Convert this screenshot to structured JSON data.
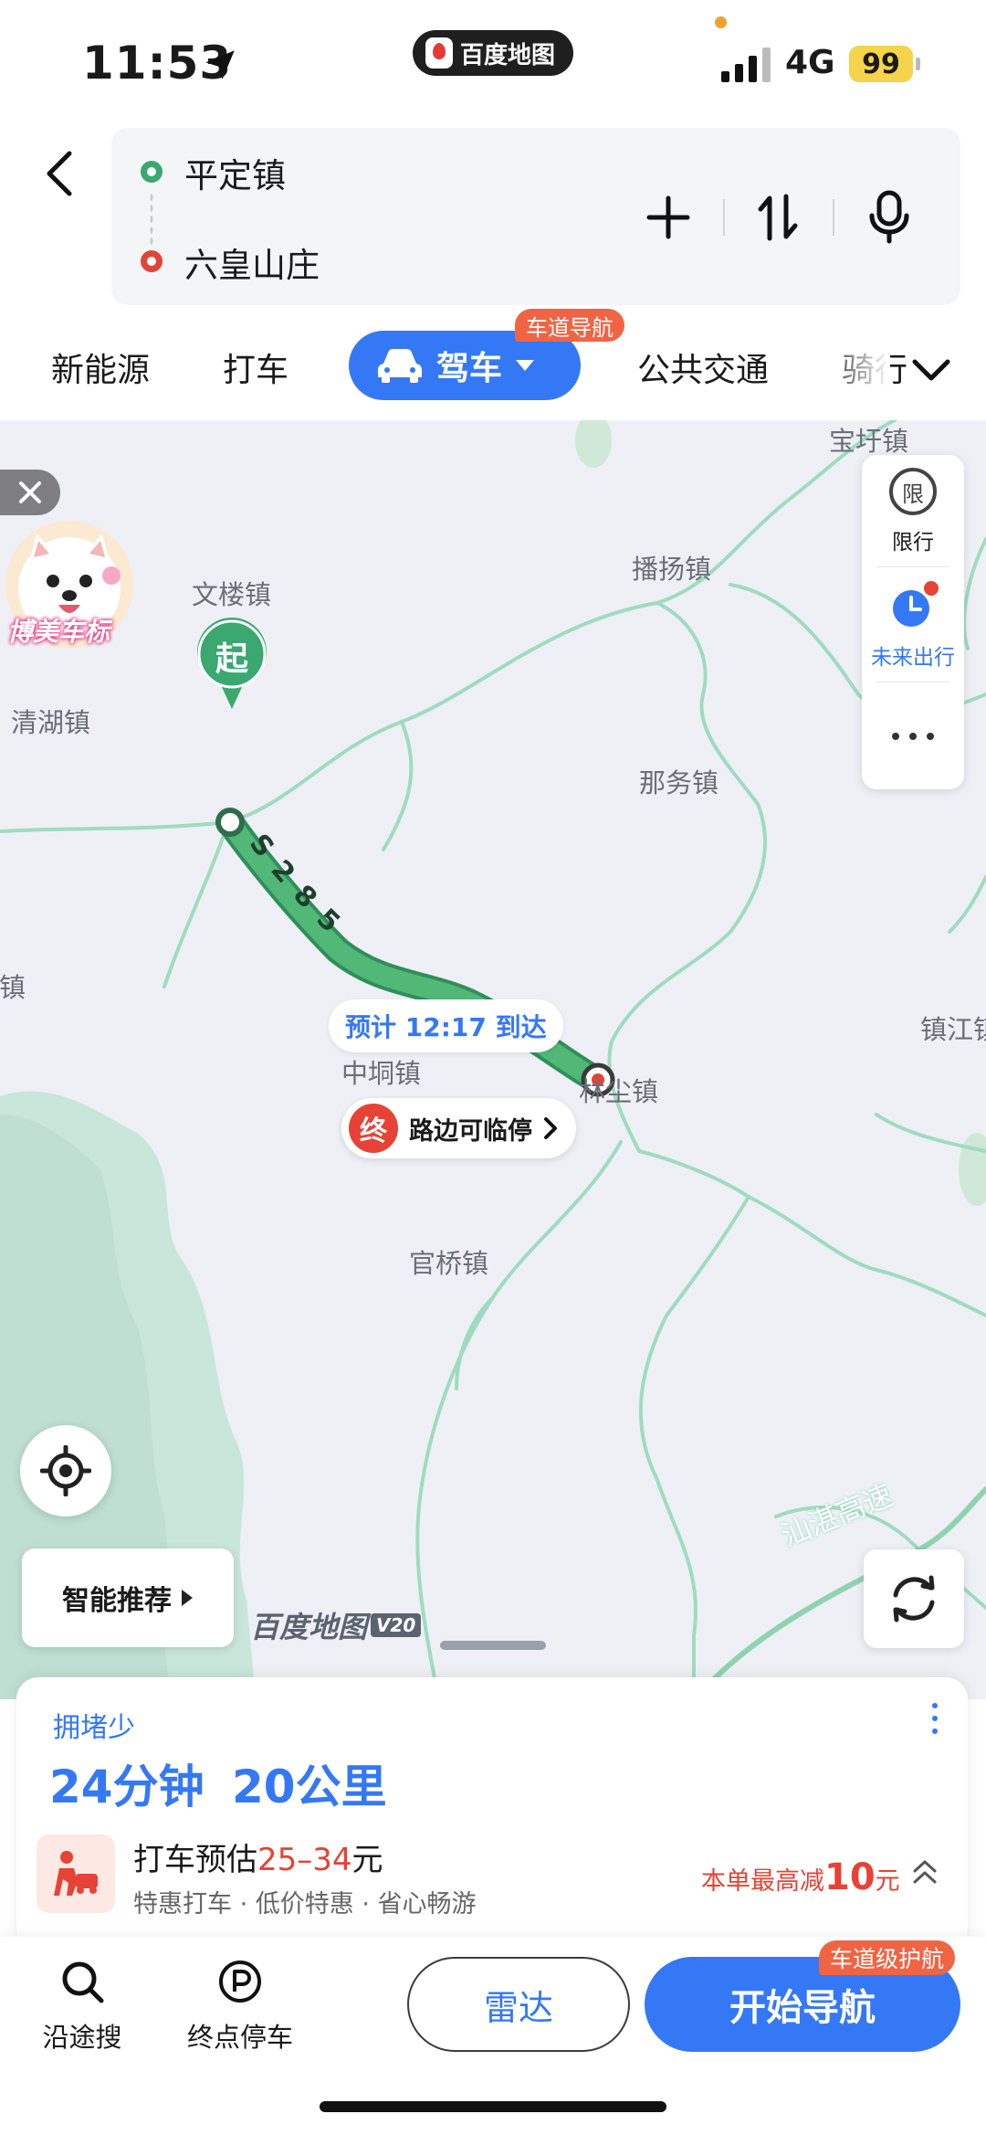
{
  "status": {
    "time": "11:53",
    "app_pill": "百度地图",
    "network": "4G",
    "battery": "99"
  },
  "route": {
    "start": "平定镇",
    "end": "六皇山庄"
  },
  "tabs": {
    "new_energy": "新能源",
    "taxi": "打车",
    "drive": "驾车",
    "drive_badge": "车道导航",
    "transit": "公共交通",
    "ride": "骑行"
  },
  "map": {
    "towns": {
      "baoxu": "宝圩镇",
      "boyang": "播扬镇",
      "wenlou": "文楼镇",
      "qinghu": "清湖镇",
      "nawu": "那务镇",
      "yong": "涌镇",
      "zhenjiang": "镇江镇",
      "zhongdong": "中垌镇",
      "linchen": "林尘镇",
      "guanqiao": "官桥镇",
      "highway": "汕湛高速"
    },
    "pet_label": "博美车标",
    "side_panel": {
      "restriction_glyph": "限",
      "restriction": "限行",
      "future": "未来出行"
    },
    "start_marker": "起",
    "route_road": "S285",
    "eta": "预计 12:17 到达",
    "end_marker": "终",
    "end_note": "路边可临停",
    "smart_recommend": "智能推荐",
    "watermark": "百度地图",
    "watermark_version": "V20"
  },
  "summary": {
    "congestion": "拥堵少",
    "duration": "24分钟",
    "distance": "20公里",
    "taxi_label": "打车预估",
    "taxi_price": "25–34",
    "taxi_unit": "元",
    "taxi_sub": "特惠打车 · 低价特惠 · 省心畅游",
    "discount_pre": "本单最高减",
    "discount_val": "10",
    "discount_unit": "元"
  },
  "bottom": {
    "along_search": "沿途搜",
    "dest_parking": "终点停车",
    "radar": "雷达",
    "start_nav": "开始导航",
    "nav_badge": "车道级护航"
  },
  "colors": {
    "accent": "#3478f6",
    "route": "#4caf6e",
    "end": "#e64235",
    "badge": "#f06444"
  }
}
